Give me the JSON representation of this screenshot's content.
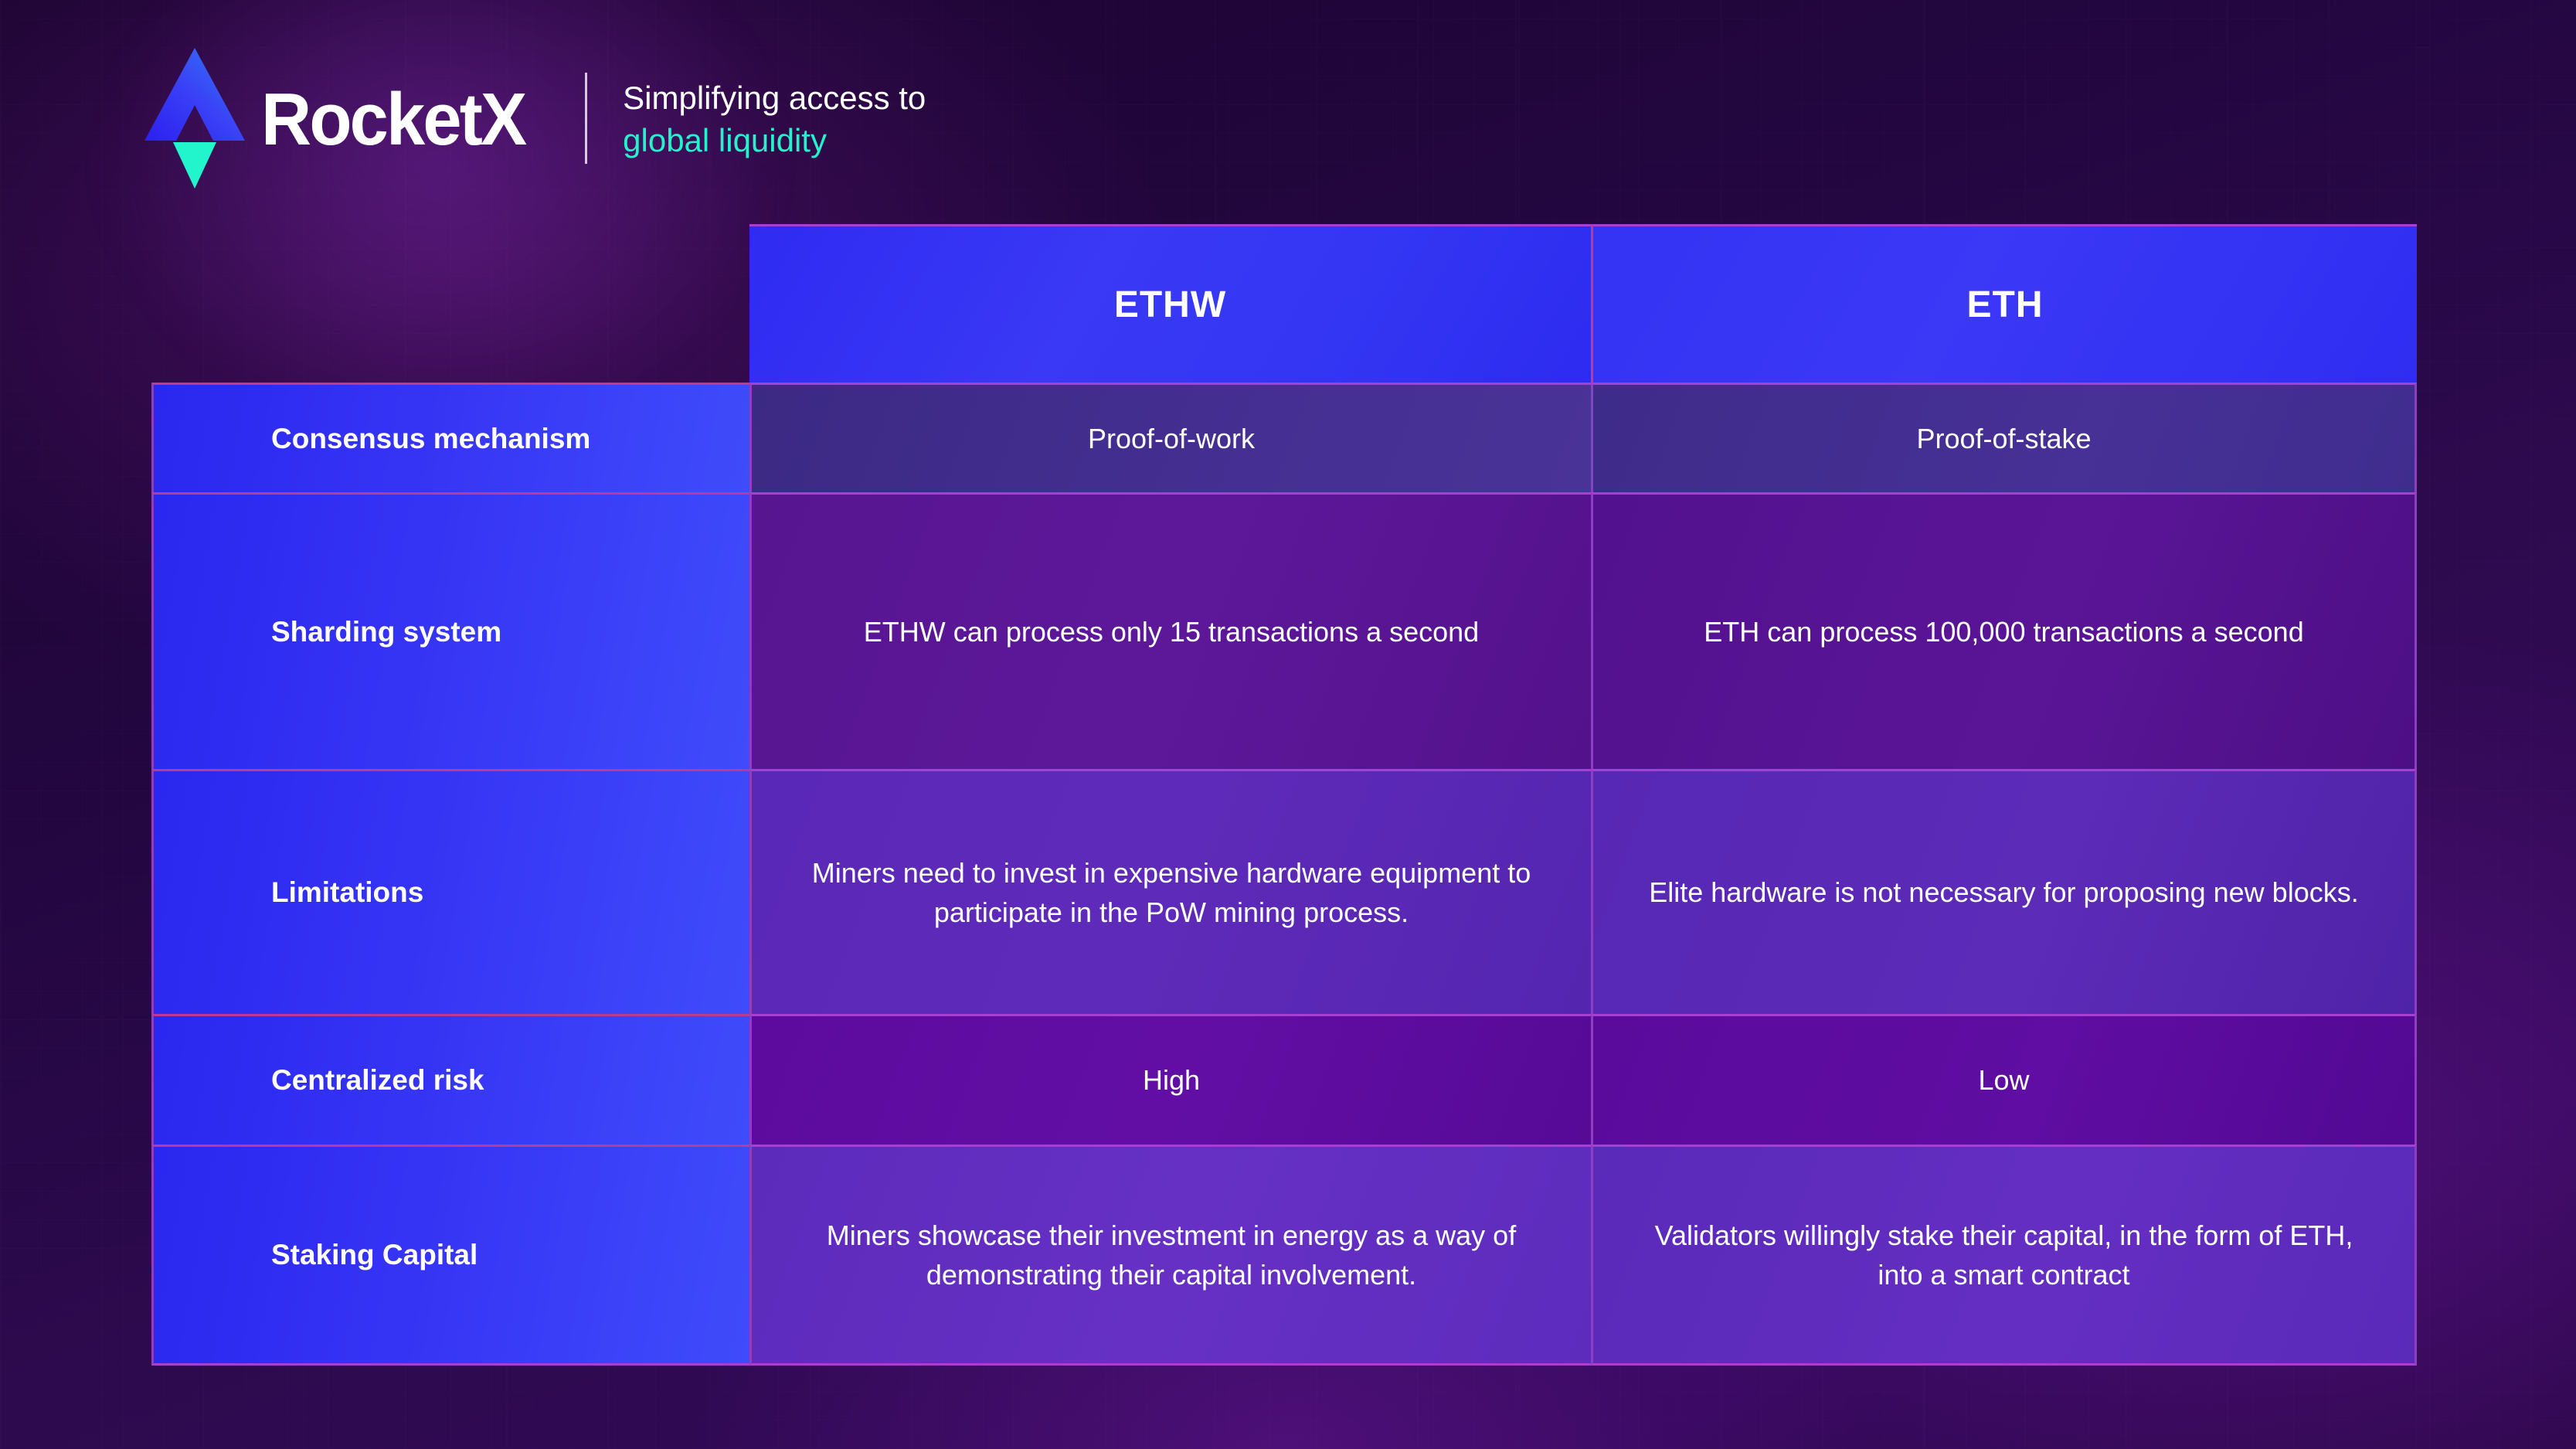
{
  "brand": {
    "name": "RocketX",
    "logo_icon": "rocketx-triangle-logo",
    "tagline_line1": "Simplifying access to",
    "tagline_line2": "global liquidity",
    "colors": {
      "accent_cyan": "#25f2cd",
      "accent_blue": "#3336f3",
      "logo_blue": "#3a46f5",
      "background_purple": "#2d0a4e",
      "border_magenta": "#a83fd0"
    }
  },
  "table": {
    "columns": [
      {
        "key": "label",
        "header": ""
      },
      {
        "key": "ethw",
        "header": "ETHW"
      },
      {
        "key": "eth",
        "header": "ETH"
      }
    ],
    "rows": [
      {
        "label": "Consensus mechanism",
        "ethw": "Proof-of-work",
        "eth": "Proof-of-stake"
      },
      {
        "label": "Sharding system",
        "ethw": "ETHW can process only 15 transactions a second",
        "eth": "ETH can process 100,000 transactions a second"
      },
      {
        "label": "Limitations",
        "ethw": "Miners need to invest in expensive hardware equipment to participate in the PoW mining process.",
        "eth": "Elite hardware is not necessary for proposing new blocks."
      },
      {
        "label": "Centralized risk",
        "ethw": "High",
        "eth": "Low"
      },
      {
        "label": "Staking Capital",
        "ethw": "Miners showcase their investment in energy as a way of demonstrating their capital involvement.",
        "eth": "Validators willingly stake their capital, in the form of ETH, into a smart contract"
      }
    ]
  }
}
